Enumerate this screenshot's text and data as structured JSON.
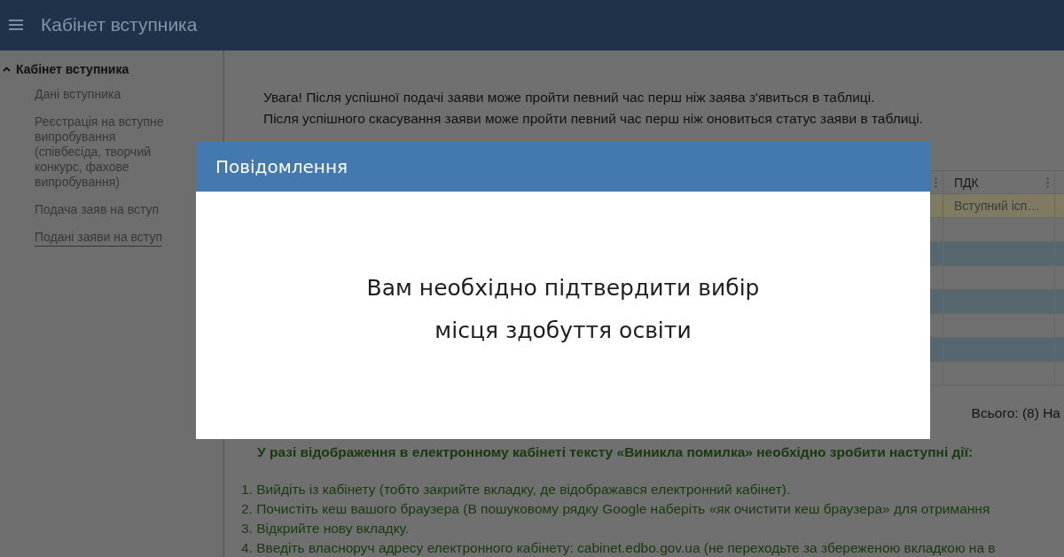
{
  "header": {
    "title": "Кабінет вступника"
  },
  "sidebar": {
    "section": {
      "label": "Кабінет вступника",
      "expanded": true
    },
    "items": [
      {
        "label": "Дані вступника",
        "selected": false
      },
      {
        "label": "Реєстрація на вступне випробування (співбесіда, творчий конкурс, фахове випробування)",
        "selected": false
      },
      {
        "label": "Подача заяв на вступ",
        "selected": false
      },
      {
        "label": "Подані заяви на вступ",
        "selected": true
      }
    ]
  },
  "notice": [
    "Увага! Після успішної подачі заяви може пройти певний час перш ніж заява з'явиться в таблиці.",
    "Після успішного скасування заяви може пройти певний час перш ніж оновиться статус заяви в таблиці."
  ],
  "table": {
    "columns": [
      {
        "label": "ПДК"
      }
    ],
    "rows": [
      {
        "cells": [
          "Вступний ісп…"
        ],
        "highlighted": true
      }
    ]
  },
  "total": "Всього: (8) На",
  "help": {
    "heading": "У разі відображення в електронному кабінеті тексту «Виникла помилка» необхідно зробити наступні дії:",
    "steps": [
      "1. Вийдіть із кабінету (тобто закрийте вкладку, де відображався електронний кабінет).",
      "2. Почистіть кеш вашого браузера (В пошуковому рядку Google наберіть «як очистити кеш браузера» для отримання",
      "3. Відкрийте нову вкладку.",
      "4. Введіть власноруч адресу електронного кабінету: cabinet.edbo.gov.ua (не переходьте за збереженою вкладкою на в"
    ]
  },
  "dialog": {
    "title": "Повідомлення",
    "message_lines": [
      "Вам необхідно підтвердити вибір",
      "місця здобуття освіти"
    ]
  }
}
